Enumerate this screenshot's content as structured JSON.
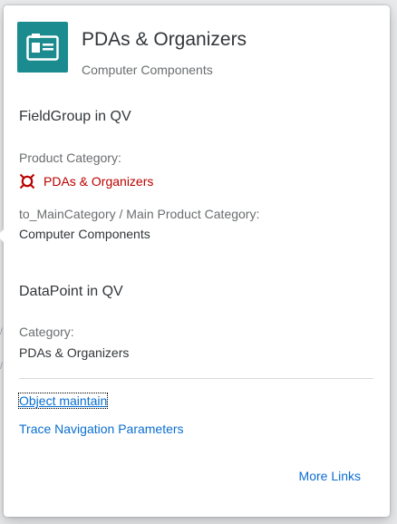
{
  "header": {
    "title": "PDAs & Organizers",
    "subtitle": "Computer Components",
    "avatar_icon": "product-card-icon",
    "avatar_color": "#1b8b8f"
  },
  "field_group": {
    "title": "FieldGroup in QV",
    "fields": [
      {
        "label": "Product Category:",
        "value": "PDAs & Organizers",
        "state": "critical",
        "state_icon": "alert-status-icon",
        "state_color": "#bb0000"
      },
      {
        "label": "to_MainCategory / Main Product Category:",
        "value": "Computer Components"
      }
    ]
  },
  "data_point": {
    "title": "DataPoint in QV",
    "fields": [
      {
        "label": "Category:",
        "value": "PDAs & Organizers"
      }
    ]
  },
  "links": [
    {
      "label": "Object maintain",
      "focused": true
    },
    {
      "label": "Trace Navigation Parameters",
      "focused": false
    }
  ],
  "footer": {
    "more_links_label": "More Links"
  },
  "colors": {
    "link": "#0a6ed1",
    "text": "#32363a",
    "label": "#6a6d70"
  }
}
